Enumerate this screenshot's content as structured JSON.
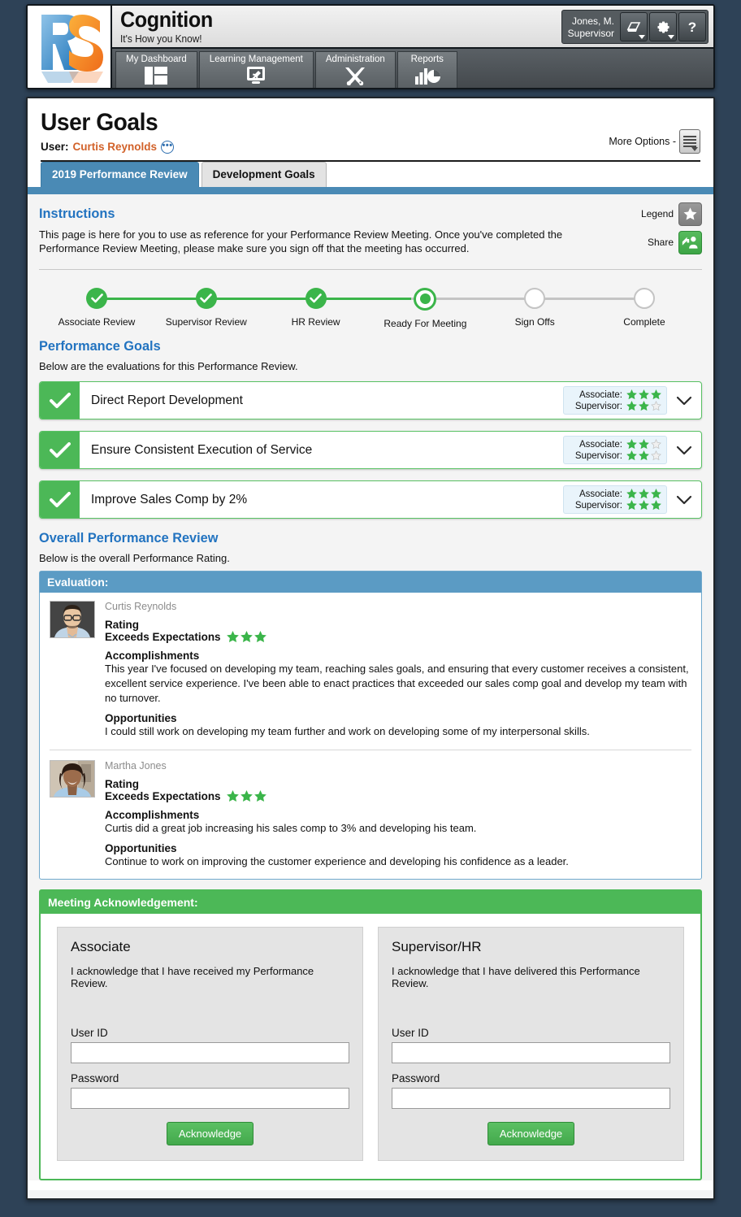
{
  "header": {
    "logo_alt": "RS logo",
    "brand_title": "Cognition",
    "brand_tagline": "It's How you Know!",
    "user_name": "Jones, M.",
    "user_role": "Supervisor",
    "icons": [
      "inbox-icon",
      "gear-icon",
      "help-icon"
    ],
    "nav_tabs": [
      {
        "label": "My Dashboard",
        "icon": "dashboard-icon"
      },
      {
        "label": "Learning Management",
        "icon": "monitor-wrench-icon"
      },
      {
        "label": "Administration",
        "icon": "tools-icon"
      },
      {
        "label": "Reports",
        "icon": "chart-pie-icon"
      }
    ]
  },
  "page": {
    "title": "User Goals",
    "user_label": "User:",
    "user_value": "Curtis Reynolds",
    "more_options_label": "More Options -"
  },
  "tabs": [
    {
      "label": "2019 Performance Review",
      "active": true
    },
    {
      "label": "Development Goals",
      "active": false
    }
  ],
  "instructions": {
    "heading": "Instructions",
    "text": "This page is here for you to use as reference for your Performance Review Meeting. Once you've completed the Performance Review Meeting, please make sure you sign off that the meeting has occurred.",
    "legend_label": "Legend",
    "share_label": "Share"
  },
  "stepper": {
    "steps": [
      {
        "label": "Associate Review",
        "state": "done"
      },
      {
        "label": "Supervisor Review",
        "state": "done"
      },
      {
        "label": "HR Review",
        "state": "done"
      },
      {
        "label": "Ready For Meeting",
        "state": "current"
      },
      {
        "label": "Sign Offs",
        "state": "todo"
      },
      {
        "label": "Complete",
        "state": "todo"
      }
    ]
  },
  "performance_goals": {
    "heading": "Performance Goals",
    "subtext": "Below are the evaluations for this Performance Review.",
    "associate_label": "Associate:",
    "supervisor_label": "Supervisor:",
    "goals": [
      {
        "title": "Direct Report Development",
        "associate_stars": 3,
        "supervisor_stars": 2,
        "max_stars": 3
      },
      {
        "title": "Ensure Consistent Execution of Service",
        "associate_stars": 2,
        "supervisor_stars": 2,
        "max_stars": 3
      },
      {
        "title": "Improve Sales Comp by 2%",
        "associate_stars": 3,
        "supervisor_stars": 3,
        "max_stars": 3
      }
    ]
  },
  "overall": {
    "heading": "Overall Performance Review",
    "subtext": "Below is the overall Performance Rating.",
    "panel_title": "Evaluation:",
    "rating_label": "Rating",
    "accomplishments_label": "Accomplishments",
    "opportunities_label": "Opportunities",
    "evaluations": [
      {
        "name": "Curtis Reynolds",
        "avatar": "male-avatar",
        "rating_text": "Exceeds Expectations",
        "rating_stars": 3,
        "max_stars": 3,
        "accomplishments": "This year I've focused on developing my team, reaching sales goals, and ensuring that every customer receives a consistent, excellent service experience. I've been able to enact practices that exceeded our sales comp goal and develop my team with no turnover.",
        "opportunities": "I could still work on developing my team further and work on developing some of my interpersonal skills."
      },
      {
        "name": "Martha Jones",
        "avatar": "female-avatar",
        "rating_text": "Exceeds Expectations",
        "rating_stars": 3,
        "max_stars": 3,
        "accomplishments": "Curtis did a great job increasing his sales comp to 3% and developing his team.",
        "opportunities": "Continue to work on improving the customer experience and developing his confidence as a leader."
      }
    ]
  },
  "acknowledgement": {
    "panel_title": "Meeting Acknowledgement:",
    "columns": [
      {
        "title": "Associate",
        "text": "I acknowledge that I have received my Performance Review.",
        "userid_label": "User ID",
        "userid_value": "",
        "password_label": "Password",
        "password_value": "",
        "button_label": "Acknowledge"
      },
      {
        "title": "Supervisor/HR",
        "text": "I acknowledge that I have delivered this Performance Review.",
        "userid_label": "User ID",
        "userid_value": "",
        "password_label": "Password",
        "password_value": "",
        "button_label": "Acknowledge"
      }
    ]
  },
  "colors": {
    "accent_blue": "#2273c0",
    "tab_blue": "#4a8ab5",
    "panel_blue": "#5b9bc4",
    "green": "#4cb857",
    "star_green": "#3bb54a",
    "orange_link": "#d2622a",
    "desktop_bg": "#2e4257"
  }
}
